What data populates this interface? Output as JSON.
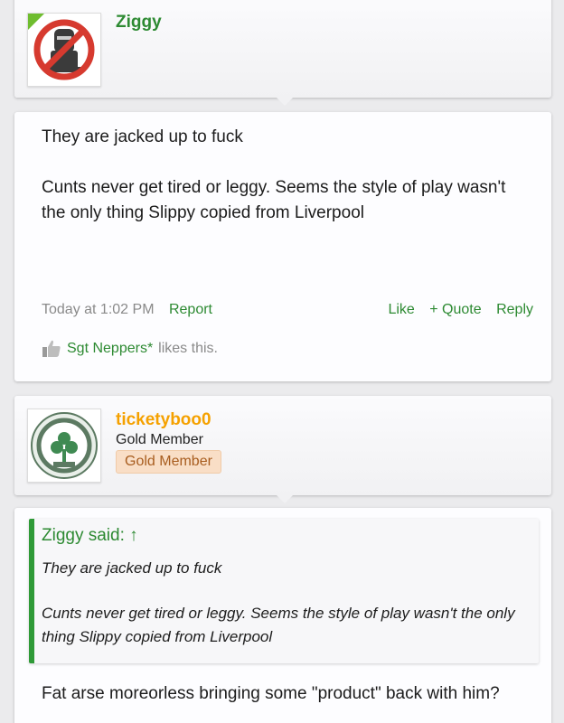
{
  "post1": {
    "username": "Ziggy",
    "username_color": "#2d8a32",
    "avatar_icon": "no-entry-robot-avatar",
    "online_indicator_color": "#6fbd2f",
    "message_line1": "They are jacked up to fuck",
    "message_line2": "Cunts never get tired or leggy. Seems the style of play wasn't the only thing Slippy copied from Liverpool",
    "timestamp": "Today at 1:02 PM",
    "report_label": "Report",
    "like_label": "Like",
    "quote_label": "+ Quote",
    "reply_label": "Reply",
    "likes_user": "Sgt Neppers*",
    "likes_suffix": "likes this."
  },
  "post2": {
    "username": "ticketyboo0",
    "username_color": "#f5a100",
    "avatar_icon": "celtic-fc-crest-avatar",
    "user_title": "Gold Member",
    "badge": "Gold Member",
    "quote": {
      "header": "Ziggy said: ↑",
      "line1": "They are jacked up to fuck",
      "line2": "Cunts never get tired or leggy. Seems the style of play wasn't the only thing Slippy copied from Liverpool"
    },
    "message": "Fat arse moreorless bringing some \"product\" back with him?"
  },
  "colors": {
    "link": "#2d8a32",
    "badge_bg": "#f9dec6",
    "badge_text": "#a85d1f"
  }
}
